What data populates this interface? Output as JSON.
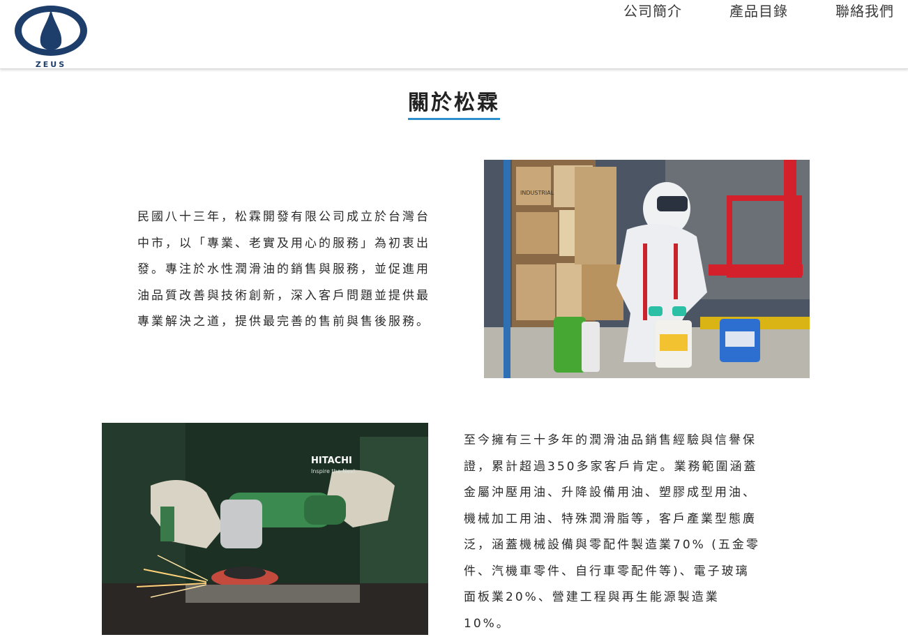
{
  "header": {
    "logo_text": "ZEUS",
    "nav": [
      "公司簡介",
      "產品目錄",
      "聯絡我們"
    ]
  },
  "about": {
    "title": "關於松霖",
    "paragraph_1_lines": [
      "民國八十三年，松霖開發有限公司成立於台灣台",
      "中市，以「專業、老實及用心的服務」為初衷出",
      "發。專注於水性潤滑油的銷售與服務，並促進用",
      "油品質改善與技術創新，深入客戶問題並提供最",
      "專業解決之道，提供最完善的售前與售後服務。"
    ],
    "paragraph_2_lines": [
      "至今擁有三十多年的潤滑油品銷售經驗與信譽保",
      "證，累計超過350多家客戶肯定。業務範圍涵蓋",
      "金屬沖壓用油、升降設備用油、塑膠成型用油、",
      "機械加工用油、特殊潤滑脂等，客戶產業型態廣",
      "泛，涵蓋機械設備與零配件製造業70% (五金零",
      "件、汽機車零件、自行車零配件等)、電子玻璃",
      "面板業20%、營建工程與再生能源製造業",
      "10%。"
    ]
  },
  "photos": {
    "photo_1_text": "INDUSTRIAL",
    "photo_2_brand": "HITACHI",
    "photo_2_tagline": "Inspire the Next"
  },
  "colors": {
    "brand_navy": "#1d3d6b",
    "title_underline": "#2e8fcf"
  },
  "icons": [
    "zeus-drop-logo-icon"
  ]
}
